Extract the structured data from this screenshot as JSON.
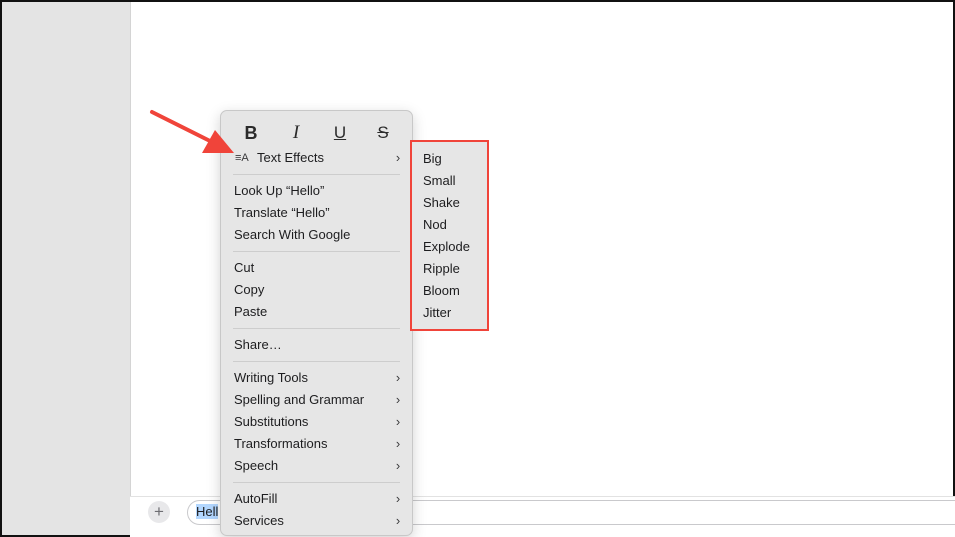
{
  "compose": {
    "message_text": "Hell",
    "plus_symbol": "+"
  },
  "format_bar": {
    "bold": "B",
    "italic": "I",
    "underline": "U",
    "strikethrough": "S"
  },
  "context_menu": {
    "text_effects": {
      "icon_glyph": "≡A",
      "label": "Text Effects"
    },
    "groups": {
      "lookup": [
        "Look Up “Hello”",
        "Translate “Hello”",
        "Search With Google"
      ],
      "edit": [
        "Cut",
        "Copy",
        "Paste"
      ],
      "share": [
        "Share…"
      ],
      "tools": [
        "Writing Tools",
        "Spelling and Grammar",
        "Substitutions",
        "Transformations",
        "Speech"
      ],
      "fill": [
        "AutoFill",
        "Services"
      ]
    },
    "chevron": "›"
  },
  "text_effects_submenu": {
    "items": [
      "Big",
      "Small",
      "Shake",
      "Nod",
      "Explode",
      "Ripple",
      "Bloom",
      "Jitter"
    ]
  },
  "colors": {
    "highlight_box": "#f0443a",
    "annotation_arrow": "#f0443a",
    "selection": "#b3d7ff",
    "menu_background": "#e6e6e6"
  }
}
